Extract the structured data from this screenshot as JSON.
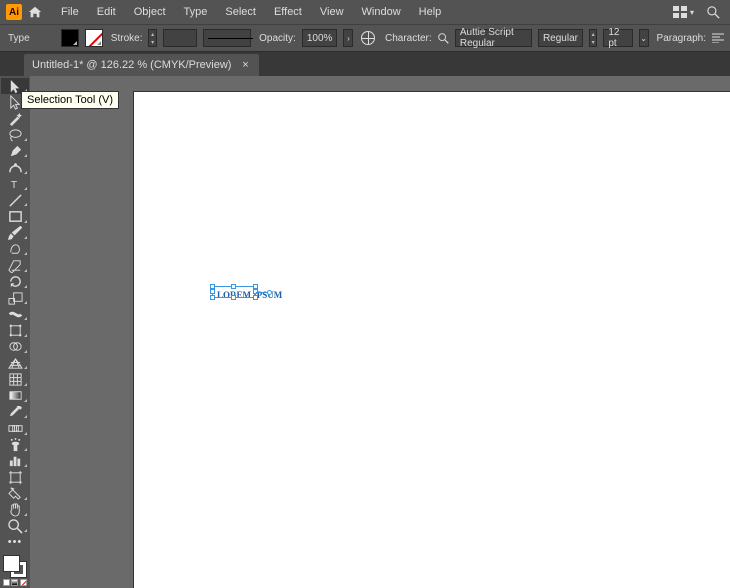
{
  "app": {
    "logo_text": "Ai"
  },
  "menu": {
    "file": "File",
    "edit": "Edit",
    "object": "Object",
    "type": "Type",
    "select": "Select",
    "effect": "Effect",
    "view": "View",
    "window": "Window",
    "help": "Help"
  },
  "options": {
    "type_label": "Type",
    "stroke_label": "Stroke:",
    "opacity_label": "Opacity:",
    "opacity_value": "100%",
    "char_label": "Character:",
    "font": "Auttie Script Regular",
    "style": "Regular",
    "size": "12 pt",
    "para_label": "Paragraph:"
  },
  "tab": {
    "title": "Untitled-1* @ 126.22 % (CMYK/Preview)"
  },
  "tooltip": "Selection Tool (V)",
  "canvas_text": "LOREM IPSUM"
}
